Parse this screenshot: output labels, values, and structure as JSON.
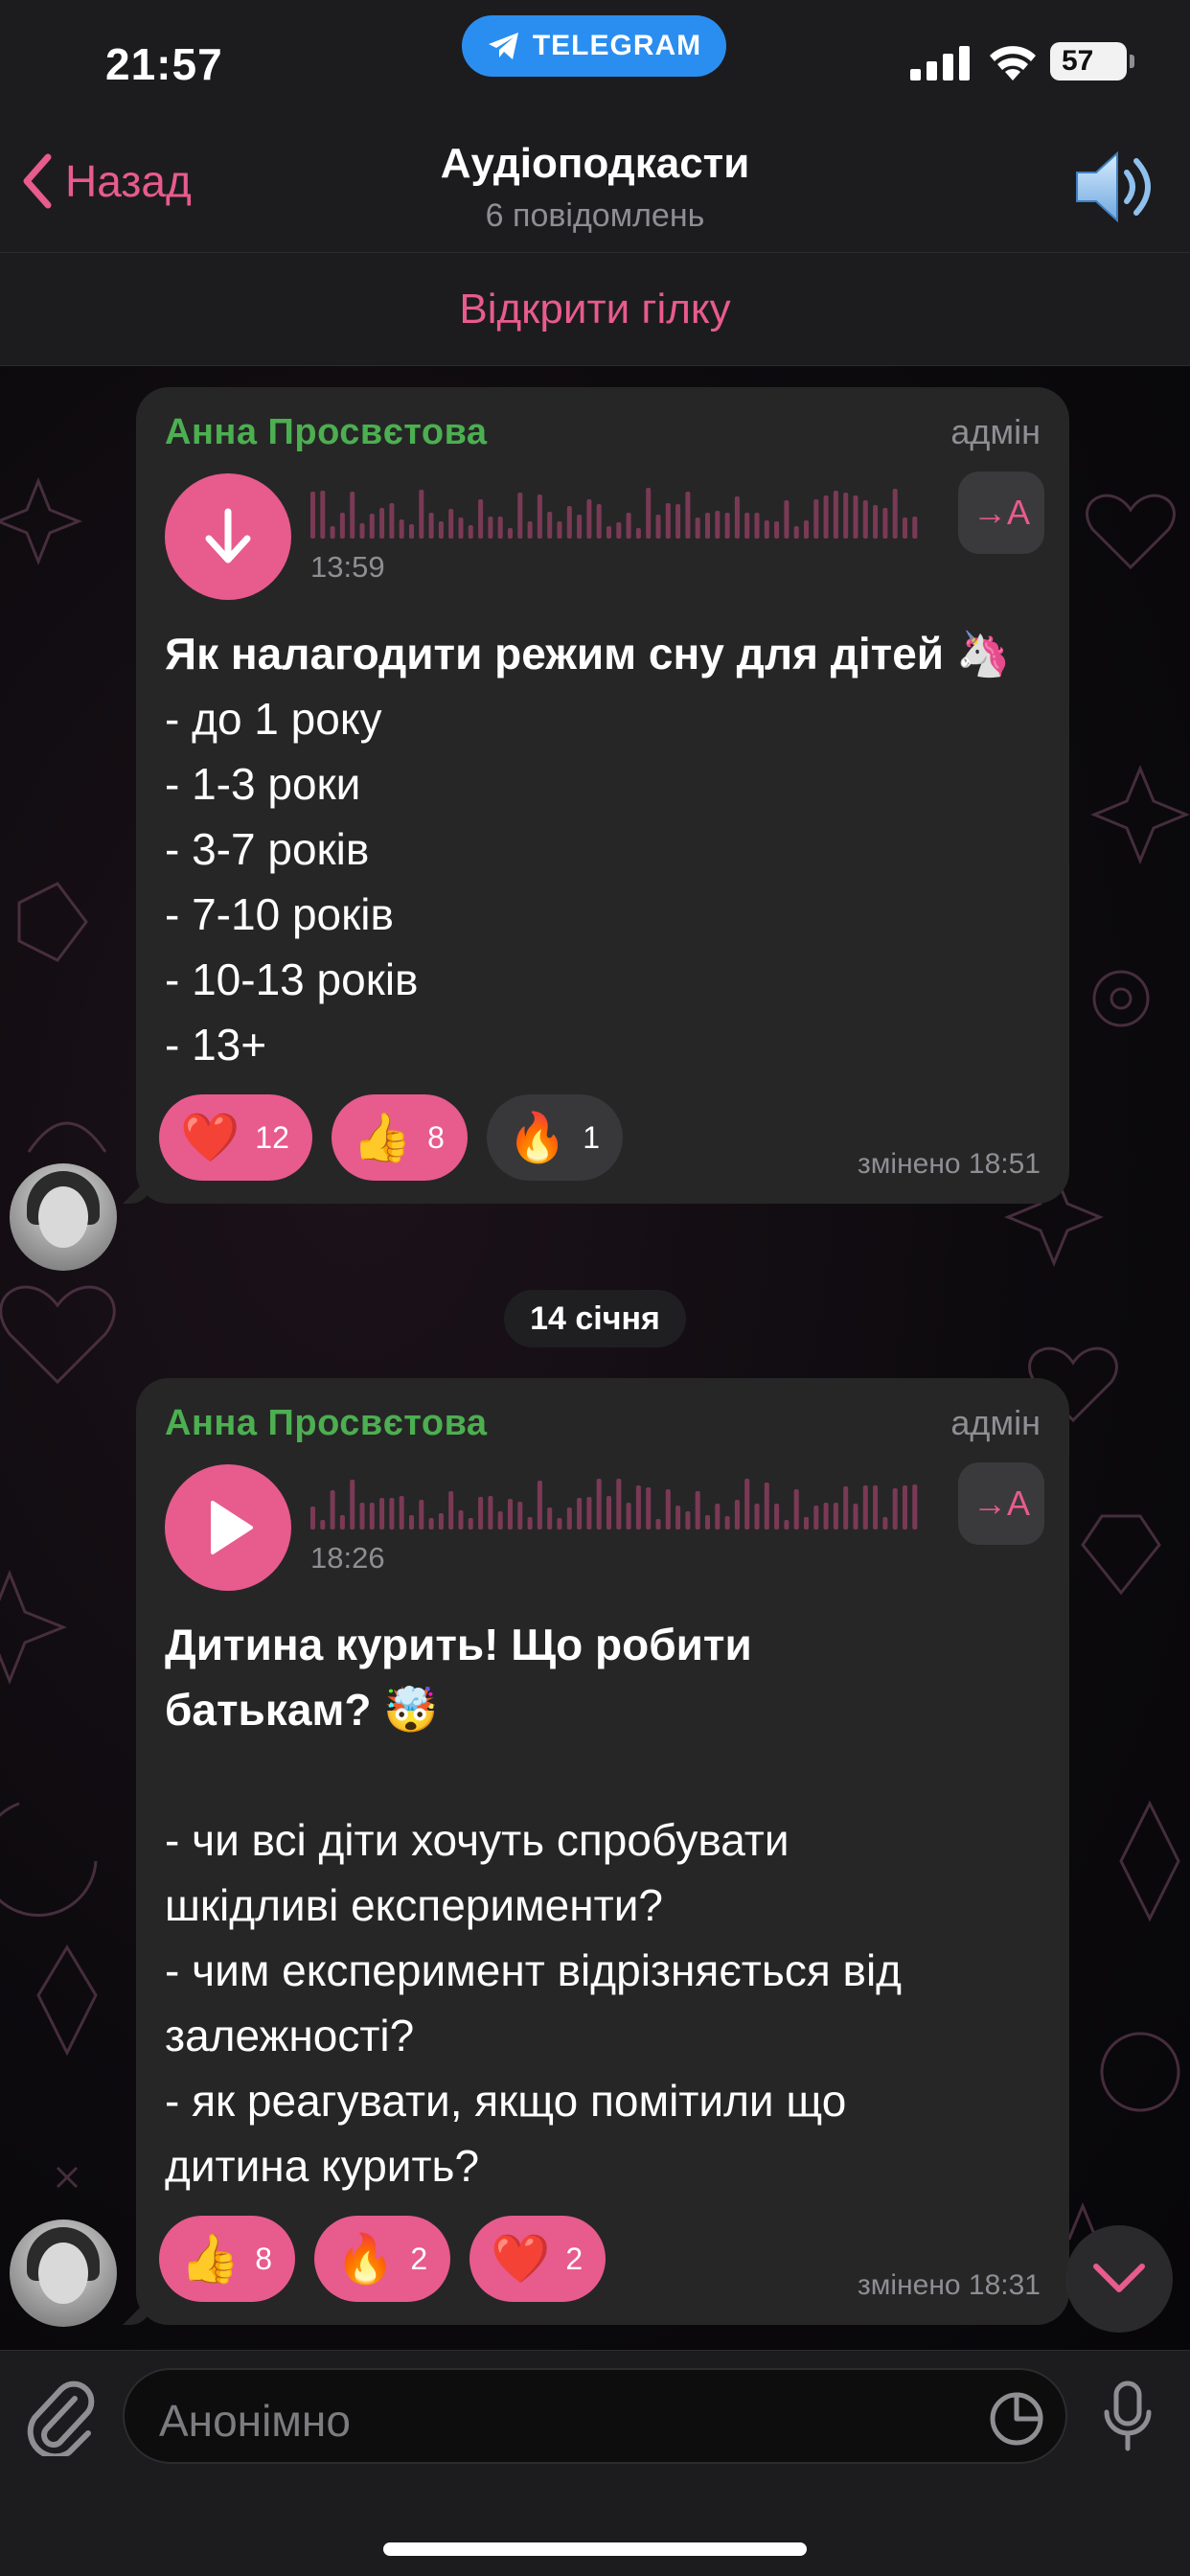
{
  "status": {
    "time": "21:57",
    "pill_label": "TELEGRAM",
    "battery": "57"
  },
  "header": {
    "back_label": "Назад",
    "title": "Аудіоподкасти",
    "subtitle": "6 повідомлень",
    "open_thread": "Відкрити гілку"
  },
  "messages": [
    {
      "sender": "Анна Просвєтова",
      "role": "адмін",
      "audio_icon": "download-arrow-icon",
      "duration": "13:59",
      "transcribe_label": "→A",
      "title": "Як налагодити режим сну для дітей 🦄",
      "lines": [
        "- до 1 року",
        "- 1-3 роки",
        "- 3-7 років",
        "- 7-10 років",
        "- 10-13 років",
        "- 13+"
      ],
      "reactions": [
        {
          "emoji": "❤️",
          "count": "12"
        },
        {
          "emoji": "👍",
          "count": "8"
        },
        {
          "emoji": "🔥",
          "count": "1"
        }
      ],
      "edited": "змінено 18:51"
    },
    {
      "sender": "Анна Просвєтова",
      "role": "адмін",
      "audio_icon": "play-icon",
      "duration": "18:26",
      "transcribe_label": "→A",
      "title_line1": "Дитина курить! Що робити",
      "title_line2": "батькам? 🤯",
      "lines": [
        "- чи всі діти хочуть спробувати",
        "шкідливі експерименти?",
        "- чим експеримент відрізняється від",
        "залежності?",
        "- як реагувати, якщо помітили що",
        "дитина курить?"
      ],
      "reactions": [
        {
          "emoji": "👍",
          "count": "8"
        },
        {
          "emoji": "🔥",
          "count": "2"
        },
        {
          "emoji": "❤️",
          "count": "2"
        }
      ],
      "edited": "змінено 18:31"
    }
  ],
  "date_separator": "14 січня",
  "input": {
    "placeholder": "Анонімно"
  },
  "colors": {
    "accent": "#e85b8d",
    "sender": "#4caf50",
    "bubble": "#262627",
    "bar": "#1c1c1e"
  }
}
